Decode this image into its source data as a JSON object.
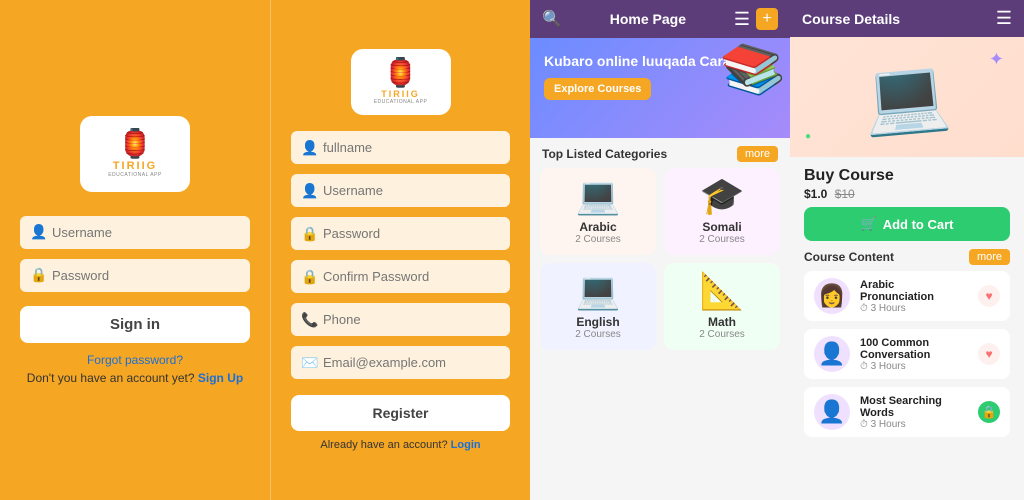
{
  "left": {
    "logo": {
      "icon": "🏮",
      "title": "TIRIIG",
      "subtitle": "EDUCATIONAL APP"
    },
    "username_placeholder": "Username",
    "password_placeholder": "Password",
    "sign_in_label": "Sign in",
    "forgot_password": "Forgot password?",
    "no_account": "Don't you have an account yet?",
    "sign_up": "Sign Up"
  },
  "middle": {
    "logo": {
      "icon": "🏮",
      "title": "TIRIIG",
      "subtitle": "EDUCATIONAL APP"
    },
    "fullname_placeholder": "fullname",
    "username_placeholder": "Username",
    "password_placeholder": "Password",
    "confirm_placeholder": "Confirm Password",
    "phone_placeholder": "Phone",
    "email_placeholder": "Email@example.com",
    "register_label": "Register",
    "already_have_account": "Already have an account?",
    "login_label": "Login"
  },
  "home": {
    "header_title": "Home Page",
    "hero": {
      "title": "Kubaro online luuqada Carabiga",
      "explore_label": "Explore Courses"
    },
    "categories_title": "Top Listed Categories",
    "more_label": "more",
    "categories": [
      {
        "name": "Arabic",
        "count": "2 Courses",
        "icon": "💻",
        "class": "cat-arabic"
      },
      {
        "name": "Somali",
        "count": "2 Courses",
        "icon": "🎓",
        "class": "cat-somali"
      },
      {
        "name": "English",
        "count": "2 Courses",
        "icon": "💻",
        "class": "cat-english"
      },
      {
        "name": "Math",
        "count": "2 Courses",
        "icon": "📐",
        "class": "cat-math"
      }
    ]
  },
  "course_details": {
    "header_title": "Course Details",
    "buy_course_title": "Buy Course",
    "new_price": "$1.0",
    "old_price": "$10",
    "add_to_cart_label": "Add to Cart",
    "course_content_title": "Course Content",
    "more_label": "more",
    "items": [
      {
        "title": "Arabic Pronunciation",
        "duration": "3 Hours",
        "icon": "👩",
        "action": "heart"
      },
      {
        "title": "100 Common Conversation",
        "duration": "3 Hours",
        "icon": "👤",
        "action": "heart"
      },
      {
        "title": "Most Searching Words",
        "duration": "3 Hours",
        "icon": "👤",
        "action": "lock"
      }
    ]
  }
}
